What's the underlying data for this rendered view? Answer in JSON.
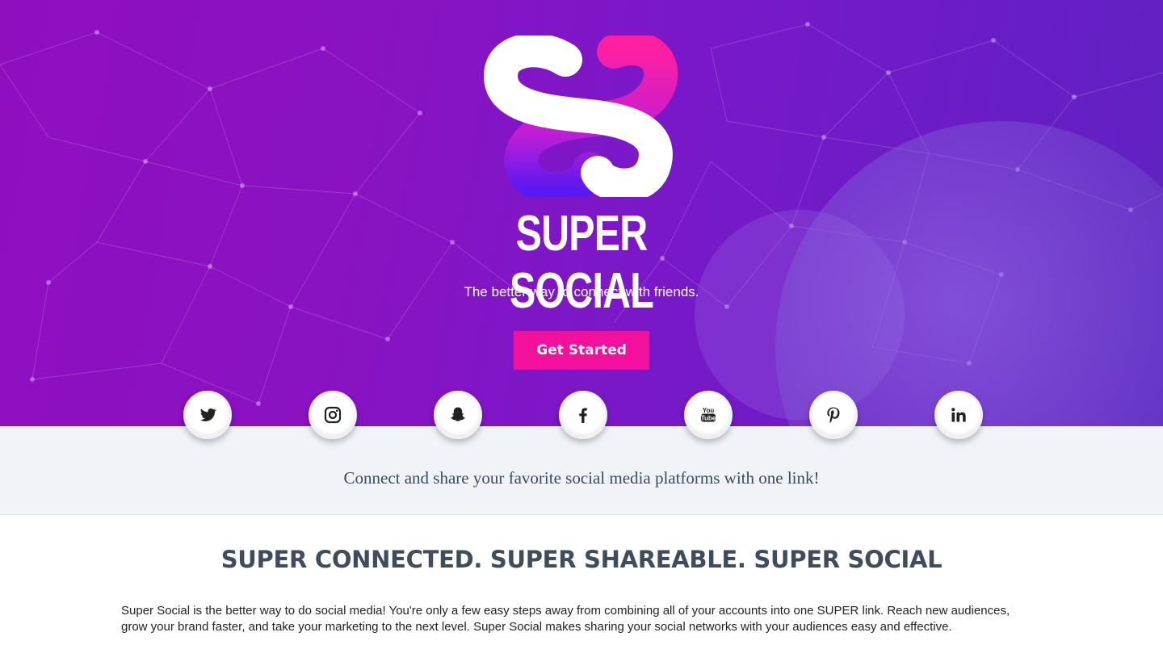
{
  "hero": {
    "brand": "SUPER SOCIAL",
    "tagline": "The better way to connect with friends.",
    "cta_label": "Get Started",
    "colors": {
      "cta": "#f2109c",
      "gradient_start": "#8f0fbf",
      "gradient_end": "#5e22c0"
    }
  },
  "social": [
    {
      "name": "twitter",
      "icon": "twitter-icon"
    },
    {
      "name": "instagram",
      "icon": "instagram-icon"
    },
    {
      "name": "snapchat",
      "icon": "snapchat-icon"
    },
    {
      "name": "facebook",
      "icon": "facebook-icon"
    },
    {
      "name": "youtube",
      "icon": "youtube-icon",
      "label": "You Tube"
    },
    {
      "name": "pinterest",
      "icon": "pinterest-icon"
    },
    {
      "name": "linkedin",
      "icon": "linkedin-icon",
      "label": "in"
    }
  ],
  "band": {
    "text": "Connect and share your favorite social media platforms with one link!"
  },
  "main": {
    "headline": "SUPER CONNECTED. SUPER SHAREABLE. SUPER SOCIAL",
    "body": "Super Social is the better way to do social media! You're only a few easy steps away from combining all of your accounts into one SUPER link. Reach new audiences, grow your brand faster, and take your marketing to the next level. Super Social makes sharing your social networks with your audiences easy and effective."
  }
}
